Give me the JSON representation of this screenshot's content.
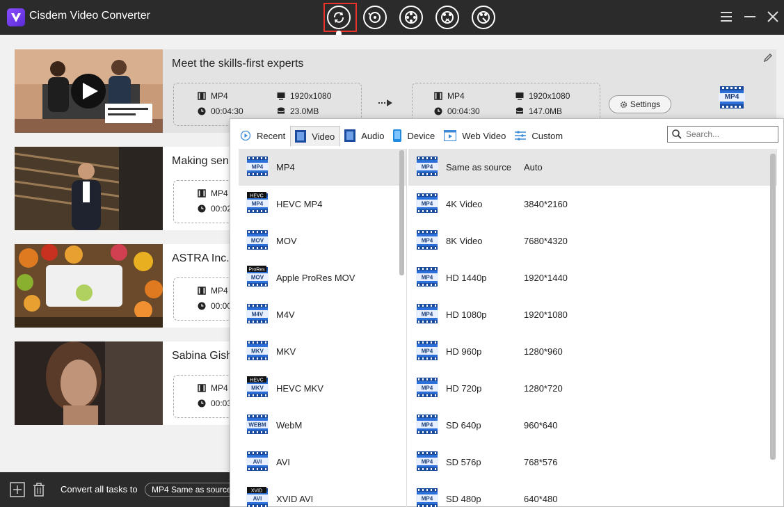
{
  "app": {
    "title": "Cisdem Video Converter"
  },
  "colors": {
    "titlebar": "#2b2b2b",
    "accent_red": "#e8332a",
    "format_blue": "#2d6fd8",
    "logo_purple": "#7a3cf0"
  },
  "toolbar": {
    "tools": [
      {
        "icon": "convert-icon",
        "active": true
      },
      {
        "icon": "rip-disc-icon",
        "active": false
      },
      {
        "icon": "film-reel-icon",
        "active": false
      },
      {
        "icon": "film-reel-cut-icon",
        "active": false
      },
      {
        "icon": "film-reel-tools-icon",
        "active": false
      }
    ]
  },
  "tasks": [
    {
      "title": "Meet the skills-first experts",
      "source": {
        "format": "MP4",
        "duration": "00:04:30",
        "resolution": "1920x1080",
        "size": "23.0MB"
      },
      "output": {
        "format": "MP4",
        "duration": "00:04:30",
        "resolution": "1920x1080",
        "size": "147.0MB"
      },
      "settings_label": "Settings",
      "target_badge": "MP4"
    },
    {
      "title": "Making sen",
      "source": {
        "format": "MP4",
        "duration": "00:02"
      }
    },
    {
      "title": "ASTRA Inc.",
      "source": {
        "format": "MP4",
        "duration": "00:00"
      }
    },
    {
      "title": "Sabina Gish",
      "source": {
        "format": "MP4",
        "duration": "00:03"
      }
    }
  ],
  "bottom": {
    "convert_label": "Convert all tasks to",
    "convert_value": "MP4 Same as source"
  },
  "panel": {
    "tabs": [
      {
        "label": "Recent",
        "icon": "recent-icon",
        "active": false
      },
      {
        "label": "Video",
        "icon": "video-icon",
        "active": true
      },
      {
        "label": "Audio",
        "icon": "audio-icon",
        "active": false
      },
      {
        "label": "Device",
        "icon": "device-icon",
        "active": false
      },
      {
        "label": "Web Video",
        "icon": "web-video-icon",
        "active": false
      },
      {
        "label": "Custom",
        "icon": "custom-icon",
        "active": false
      }
    ],
    "search_placeholder": "Search...",
    "formats": [
      {
        "name": "MP4",
        "badge": "MP4",
        "top_badge": ""
      },
      {
        "name": "HEVC MP4",
        "badge": "MP4",
        "top_badge": "HEVC"
      },
      {
        "name": "MOV",
        "badge": "MOV",
        "top_badge": ""
      },
      {
        "name": "Apple ProRes MOV",
        "badge": "MOV",
        "top_badge": "ProRes"
      },
      {
        "name": "M4V",
        "badge": "M4V",
        "top_badge": ""
      },
      {
        "name": "MKV",
        "badge": "MKV",
        "top_badge": ""
      },
      {
        "name": "HEVC MKV",
        "badge": "MKV",
        "top_badge": "HEVC"
      },
      {
        "name": "WebM",
        "badge": "WEBM",
        "top_badge": ""
      },
      {
        "name": "AVI",
        "badge": "AVI",
        "top_badge": ""
      },
      {
        "name": "XVID AVI",
        "badge": "AVI",
        "top_badge": "XVID"
      }
    ],
    "presets": [
      {
        "name": "Same as source",
        "res": "Auto"
      },
      {
        "name": "4K Video",
        "res": "3840*2160"
      },
      {
        "name": "8K Video",
        "res": "7680*4320"
      },
      {
        "name": "HD 1440p",
        "res": "1920*1440"
      },
      {
        "name": "HD 1080p",
        "res": "1920*1080"
      },
      {
        "name": "HD 960p",
        "res": "1280*960"
      },
      {
        "name": "HD 720p",
        "res": "1280*720"
      },
      {
        "name": "SD 640p",
        "res": "960*640"
      },
      {
        "name": "SD 576p",
        "res": "768*576"
      },
      {
        "name": "SD 480p",
        "res": "640*480"
      }
    ],
    "preset_badge": "MP4"
  }
}
